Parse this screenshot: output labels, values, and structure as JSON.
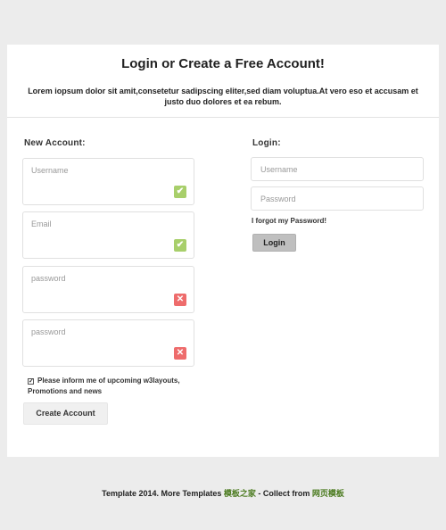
{
  "header": {
    "title": "Login or Create a Free Account!",
    "subtitle": "Lorem iopsum dolor sit amit,consetetur sadipscing eliter,sed diam voluptua.At vero eso et accusam et justo duo dolores et ea rebum."
  },
  "register": {
    "heading": "New Account:",
    "fields": [
      {
        "placeholder": "Username",
        "status": "valid",
        "status_icon": "check-icon"
      },
      {
        "placeholder": "Email",
        "status": "valid",
        "status_icon": "check-icon"
      },
      {
        "placeholder": "password",
        "status": "invalid",
        "status_icon": "cross-icon"
      },
      {
        "placeholder": "password",
        "status": "invalid",
        "status_icon": "cross-icon"
      }
    ],
    "checkbox_label": "Please inform me of upcoming w3layouts, Promotions and news",
    "checkbox_checked": true,
    "submit_label": "Create Account"
  },
  "login": {
    "heading": "Login:",
    "username_placeholder": "Username",
    "password_placeholder": "Password",
    "forgot_label": "I forgot my Password!",
    "submit_label": "Login"
  },
  "footer": {
    "prefix": "Template 2014. More Templates ",
    "link1": "模板之家",
    "middle": " - Collect from ",
    "link2": "网页模板"
  },
  "colors": {
    "valid": "#a8cf6b",
    "invalid": "#ee6c6c",
    "footer_link": "#4a7a1e"
  }
}
